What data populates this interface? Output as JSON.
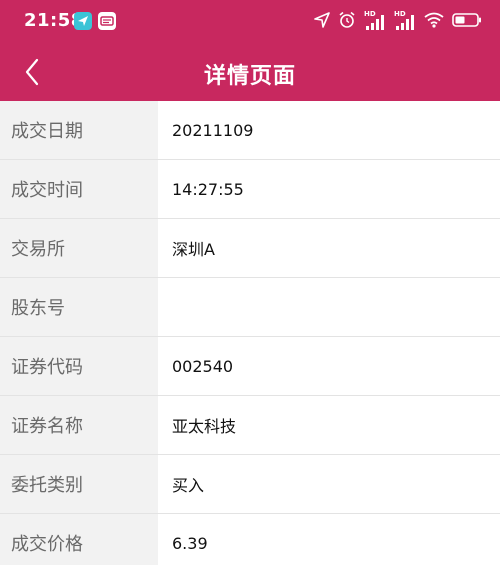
{
  "status_bar": {
    "time": "21:58",
    "hd_label_1": "HD",
    "hd_label_2": "HD"
  },
  "header": {
    "title": "详情页面"
  },
  "rows": [
    {
      "label": "成交日期",
      "value": "20211109"
    },
    {
      "label": "成交时间",
      "value": "14:27:55"
    },
    {
      "label": "交易所",
      "value": "深圳A"
    },
    {
      "label": "股东号",
      "value": ""
    },
    {
      "label": "证券代码",
      "value": "002540"
    },
    {
      "label": "证券名称",
      "value": "亚太科技"
    },
    {
      "label": "委托类别",
      "value": "买入"
    },
    {
      "label": "成交价格",
      "value": "6.39"
    }
  ],
  "colors": {
    "brand": "#c8285f",
    "label_bg": "#f2f2f2",
    "divider": "#e3e3e3"
  },
  "icons": {
    "back": "chevron-left-icon",
    "location": "location-arrow-icon",
    "alarm": "alarm-clock-icon",
    "signal": "signal-bars-icon",
    "wifi": "wifi-icon",
    "battery": "battery-icon"
  }
}
